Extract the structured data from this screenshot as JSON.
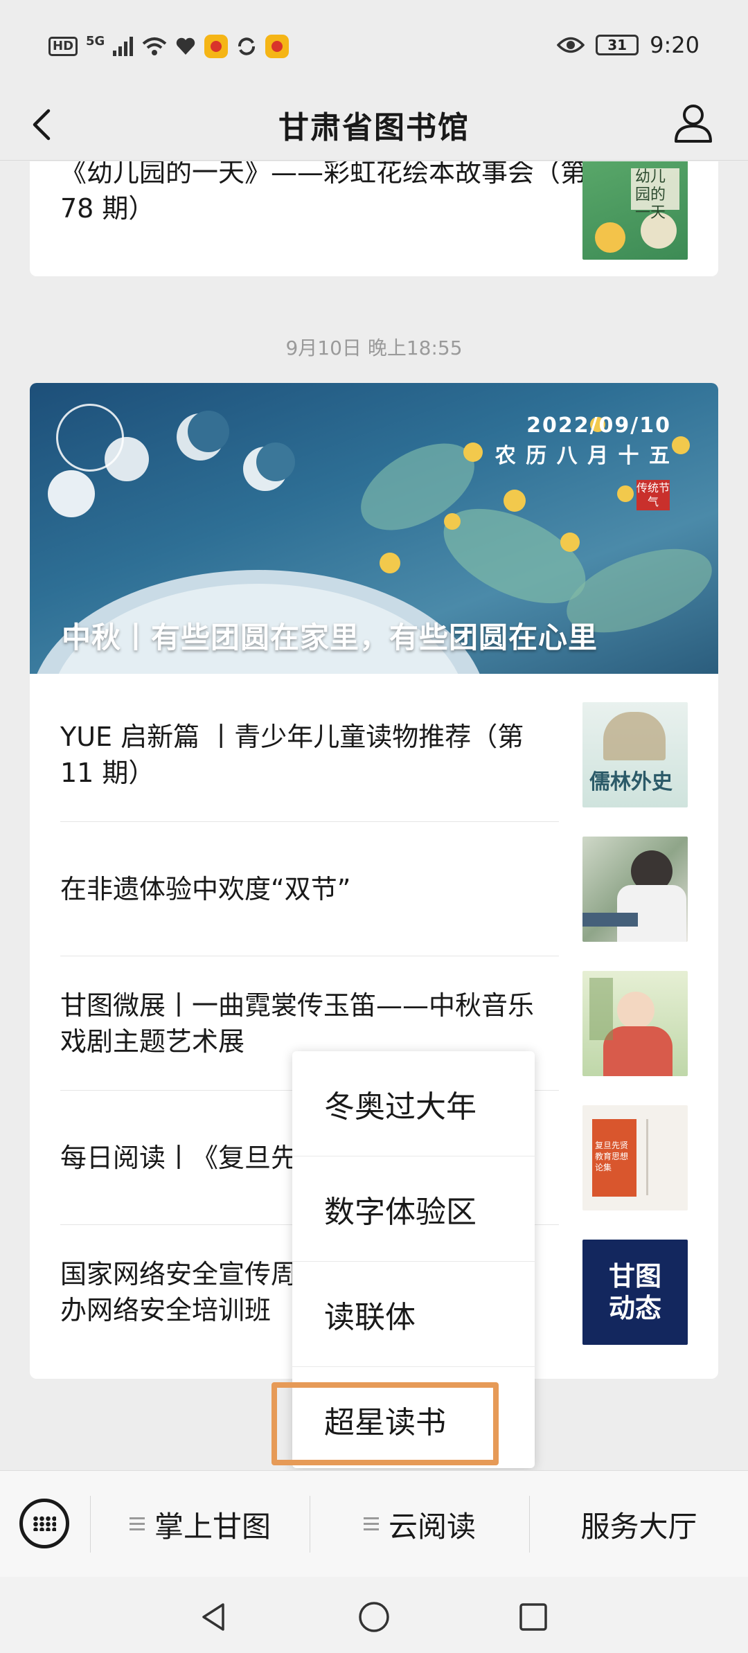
{
  "status_bar": {
    "network": "HD",
    "signal": "5G",
    "battery": "31",
    "time": "9:20"
  },
  "nav": {
    "title": "甘肃省图书馆",
    "back_icon": "chevron-left-icon",
    "profile_icon": "user-icon"
  },
  "feed": {
    "top_article": {
      "title": "《幼儿园的一天》——彩虹花绘本故事会（第 78 期）",
      "thumb_text": "幼儿园的一天"
    },
    "timestamp": "9月10日 晚上18:55",
    "cover": {
      "date": "2022/09/10",
      "lunar": "农 历 八 月 十 五",
      "seal": "传统节气",
      "title": "中秋丨有些团圆在家里，有些团圆在心里"
    },
    "articles": [
      {
        "title": "YUE 启新篇 丨青少年儿童读物推荐（第 11 期）",
        "thumb_text": "儒林外史"
      },
      {
        "title": "在非遗体验中欢度“双节”",
        "thumb_text": ""
      },
      {
        "title": "甘图微展丨一曲霓裳传玉笛——中秋音乐戏剧主题艺术展",
        "thumb_text": ""
      },
      {
        "title": "每日阅读丨《复旦先",
        "thumb_text": "复旦先贤教育思想论集"
      },
      {
        "title": "国家网络安全宣传周　　　　　　　　　办网络安全培训班",
        "thumb_text": "甘图动态"
      }
    ]
  },
  "popup_menu": {
    "items": [
      "冬奥过大年",
      "数字体验区",
      "读联体",
      "超星读书"
    ],
    "highlighted_index": 3
  },
  "bottom_menu": {
    "tabs": [
      "掌上甘图",
      "云阅读",
      "服务大厅"
    ]
  },
  "colors": {
    "highlight": "#e69a57",
    "background": "#ededed"
  }
}
